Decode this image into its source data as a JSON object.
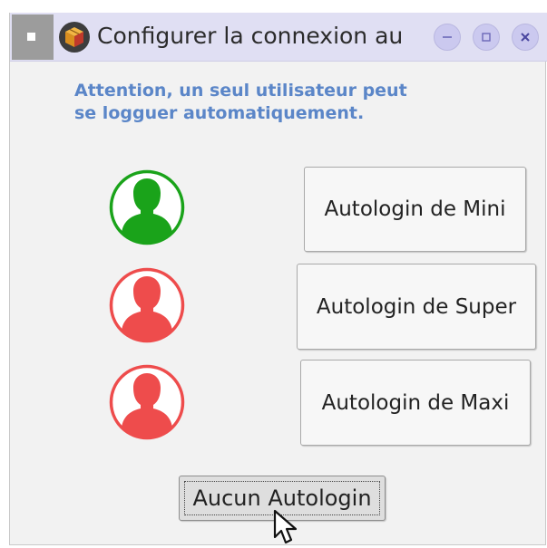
{
  "window": {
    "title": "Configurer la connexion au"
  },
  "icons": {
    "menu": "window-menu-icon",
    "app": "package-box-icon",
    "minimize": "minimize-icon",
    "maximize": "maximize-icon",
    "close": "close-icon",
    "user": "user-silhouette-icon",
    "cursor": "mouse-pointer-icon"
  },
  "message": {
    "line1": "Attention, un seul utilisateur peut",
    "line2": "se logguer automatiquement."
  },
  "users": [
    {
      "button_label": "Autologin de Mini",
      "status_color": "#1aa31a",
      "status": "active"
    },
    {
      "button_label": "Autologin de Super",
      "status_color": "#ee4c4c",
      "status": "inactive"
    },
    {
      "button_label": "Autologin de Maxi",
      "status_color": "#ee4c4c",
      "status": "inactive"
    }
  ],
  "footer": {
    "none_button_label": "Aucun Autologin"
  },
  "colors": {
    "titlebar": "#e0dff3",
    "message_text": "#5b86c8",
    "active_user": "#1aa31a",
    "inactive_user": "#ee4c4c"
  }
}
